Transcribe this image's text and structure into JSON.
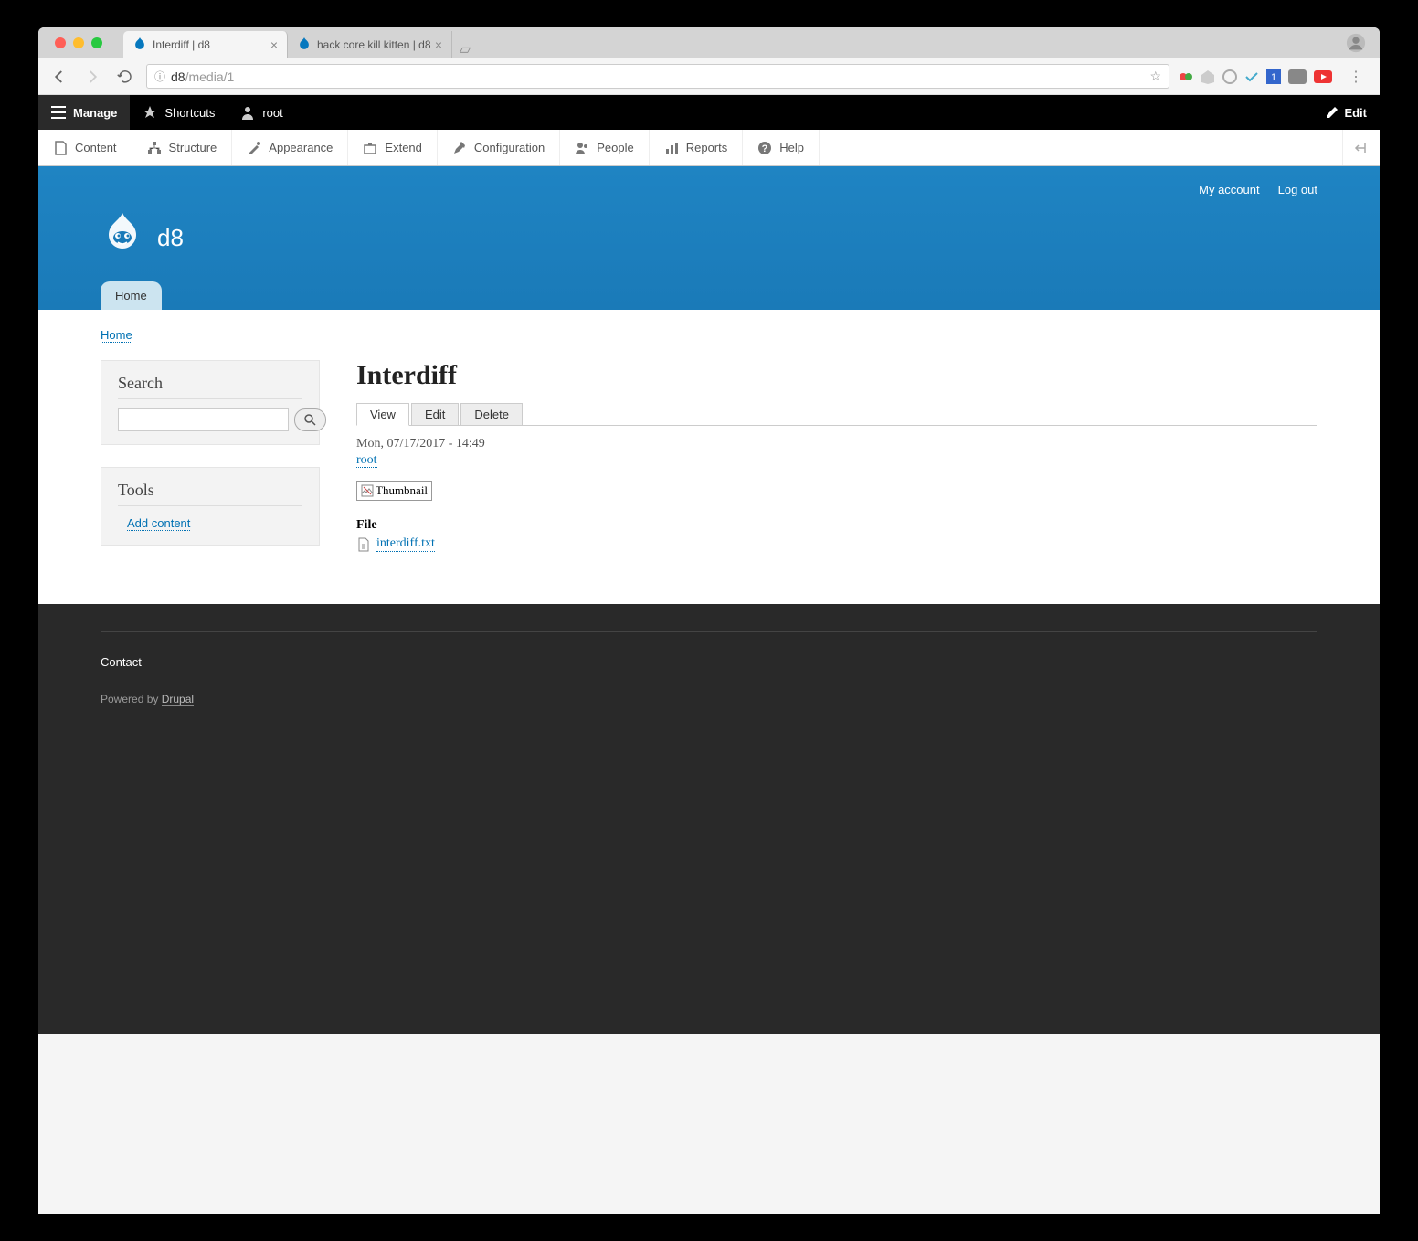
{
  "browser": {
    "tabs": [
      {
        "title": "Interdiff | d8",
        "active": true
      },
      {
        "title": "hack core kill kitten | d8",
        "active": false
      }
    ],
    "url_host": "d8",
    "url_path": "/media/1"
  },
  "toolbar": {
    "manage": "Manage",
    "shortcuts": "Shortcuts",
    "user": "root",
    "edit": "Edit"
  },
  "admin_menu": [
    "Content",
    "Structure",
    "Appearance",
    "Extend",
    "Configuration",
    "People",
    "Reports",
    "Help"
  ],
  "header": {
    "my_account": "My account",
    "logout": "Log out",
    "site_name": "d8",
    "home_tab": "Home"
  },
  "breadcrumb": "Home",
  "sidebar": {
    "search_title": "Search",
    "tools_title": "Tools",
    "add_content": "Add content"
  },
  "content": {
    "title": "Interdiff",
    "tabs": {
      "view": "View",
      "edit": "Edit",
      "delete": "Delete"
    },
    "submitted": "Mon, 07/17/2017 - 14:49",
    "author": "root",
    "thumbnail_alt": "Thumbnail",
    "file_label": "File",
    "file_name": "interdiff.txt"
  },
  "footer": {
    "contact": "Contact",
    "powered_prefix": "Powered by ",
    "powered_link": "Drupal"
  }
}
